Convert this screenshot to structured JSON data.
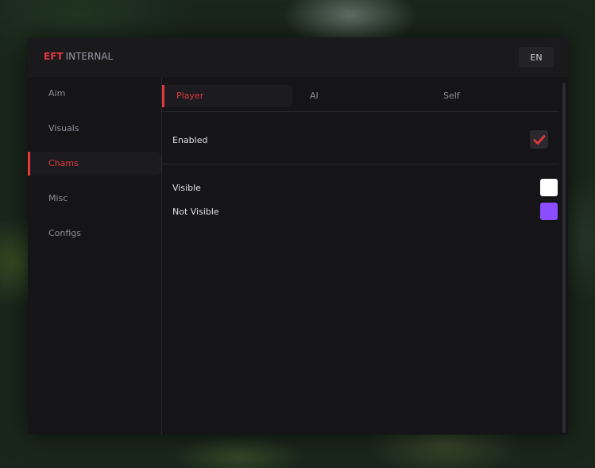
{
  "brand": {
    "accent": "EFT",
    "rest": "INTERNAL"
  },
  "language": "EN",
  "sidebar": {
    "items": [
      {
        "label": "Aim"
      },
      {
        "label": "Visuals"
      },
      {
        "label": "Chams",
        "active": true
      },
      {
        "label": "Misc"
      },
      {
        "label": "Configs"
      }
    ]
  },
  "tabs": [
    {
      "label": "Player",
      "active": true
    },
    {
      "label": "AI"
    },
    {
      "label": "Self"
    }
  ],
  "settings": {
    "enabled": {
      "label": "Enabled",
      "checked": true
    },
    "visible": {
      "label": "Visible",
      "color": "#ffffff"
    },
    "not_visible": {
      "label": "Not Visible",
      "color": "#8b4dff"
    }
  },
  "colors": {
    "accent": "#e5383b",
    "panel": "#151518",
    "titlebar": "#1a1a1d"
  }
}
